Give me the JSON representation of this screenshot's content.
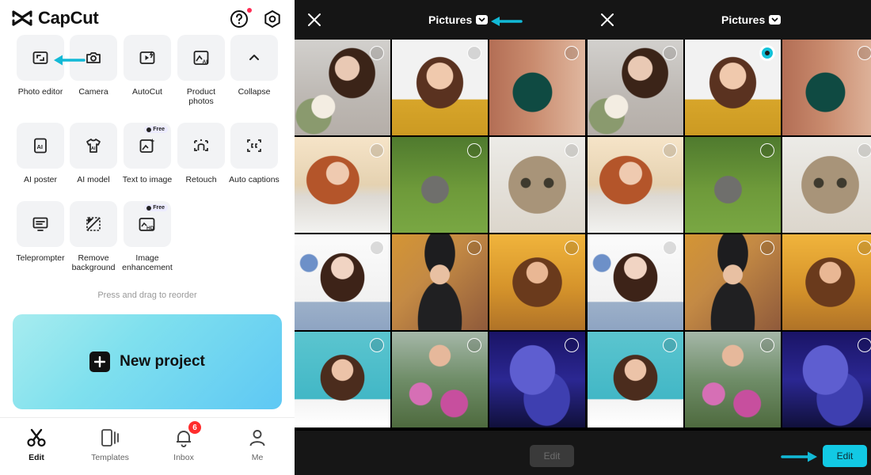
{
  "app": {
    "name": "CapCut"
  },
  "tools": [
    {
      "label": "Photo editor",
      "icon": "photo-editor-icon"
    },
    {
      "label": "Camera",
      "icon": "camera-icon"
    },
    {
      "label": "AutoCut",
      "icon": "autocut-icon"
    },
    {
      "label": "Product photos",
      "icon": "product-photos-icon"
    },
    {
      "label": "Collapse",
      "icon": "chevron-up-icon"
    },
    {
      "label": "AI poster",
      "icon": "ai-poster-icon"
    },
    {
      "label": "AI model",
      "icon": "ai-model-icon"
    },
    {
      "label": "Text to image",
      "icon": "text-to-image-icon",
      "badge": "Free"
    },
    {
      "label": "Retouch",
      "icon": "retouch-icon"
    },
    {
      "label": "Auto captions",
      "icon": "auto-captions-icon"
    },
    {
      "label": "Teleprompter",
      "icon": "teleprompter-icon"
    },
    {
      "label": "Remove background",
      "icon": "remove-background-icon"
    },
    {
      "label": "Image enhancement",
      "icon": "image-enhancement-icon",
      "badge": "Free"
    }
  ],
  "hint": "Press and drag to reorder",
  "new_project": {
    "label": "New project"
  },
  "nav": {
    "edit": "Edit",
    "templates": "Templates",
    "inbox": "Inbox",
    "inbox_count": "6",
    "me": "Me"
  },
  "picker": {
    "title": "Pictures",
    "edit_label": "Edit",
    "selected_index": 1
  },
  "colors": {
    "accent": "#12c9e4",
    "arrow": "#12b9d6",
    "badge": "#ff2d2d",
    "dark_panel": "#151515"
  }
}
